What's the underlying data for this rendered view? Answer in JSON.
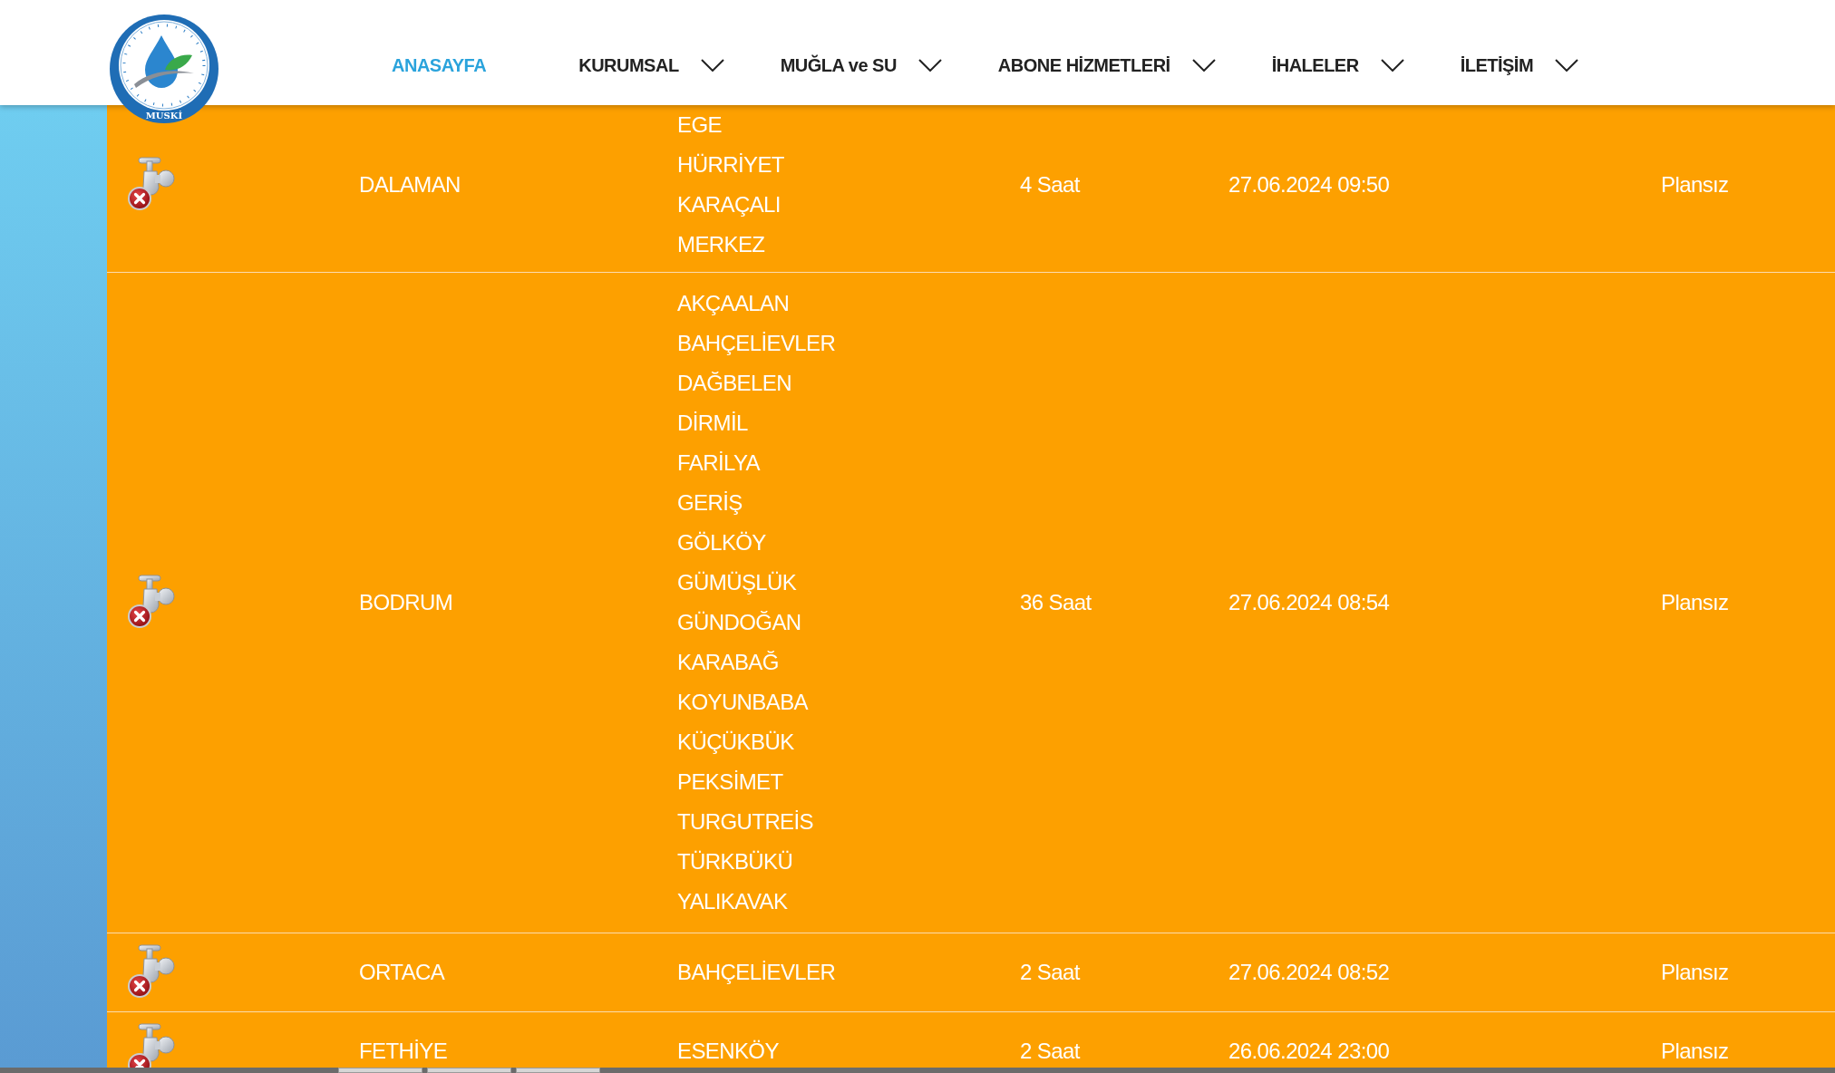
{
  "header": {
    "logo": {
      "text": "MUSKİ"
    },
    "nav": [
      {
        "label": "ANASAYFA",
        "selected": true,
        "dropdown": false
      },
      {
        "label": "KURUMSAL",
        "selected": false,
        "dropdown": true
      },
      {
        "label": "MUĞLA ve SU",
        "selected": false,
        "dropdown": true
      },
      {
        "label": "ABONE HİZMETLERİ",
        "selected": false,
        "dropdown": true
      },
      {
        "label": "İHALELER",
        "selected": false,
        "dropdown": true
      },
      {
        "label": "İLETİŞİM",
        "selected": false,
        "dropdown": true
      }
    ]
  },
  "outages": {
    "rows": [
      {
        "city": "DALAMAN",
        "neighborhoods": [
          "EGE",
          "HÜRRİYET",
          "KARAÇALI",
          "MERKEZ"
        ],
        "duration": "4 Saat",
        "date": "27.06.2024 09:50",
        "type": "Plansız"
      },
      {
        "city": "BODRUM",
        "neighborhoods": [
          "AKÇAALAN",
          "BAHÇELİEVLER",
          "DAĞBELEN",
          "DİRMİL",
          "FARİLYA",
          "GERİŞ",
          "GÖLKÖY",
          "GÜMÜŞLÜK",
          "GÜNDOĞAN",
          "KARABAĞ",
          "KOYUNBABA",
          "KÜÇÜKBÜK",
          "PEKSİMET",
          "TURGUTREİS",
          "TÜRKBÜKÜ",
          "YALIKAVAK"
        ],
        "duration": "36 Saat",
        "date": "27.06.2024 08:54",
        "type": "Plansız"
      },
      {
        "city": "ORTACA",
        "neighborhoods": [
          "BAHÇELİEVLER"
        ],
        "duration": "2 Saat",
        "date": "27.06.2024 08:52",
        "type": "Plansız"
      },
      {
        "city": "FETHİYE",
        "neighborhoods": [
          "ESENKÖY"
        ],
        "duration": "2 Saat",
        "date": "26.06.2024 23:00",
        "type": "Plansız"
      }
    ]
  }
}
